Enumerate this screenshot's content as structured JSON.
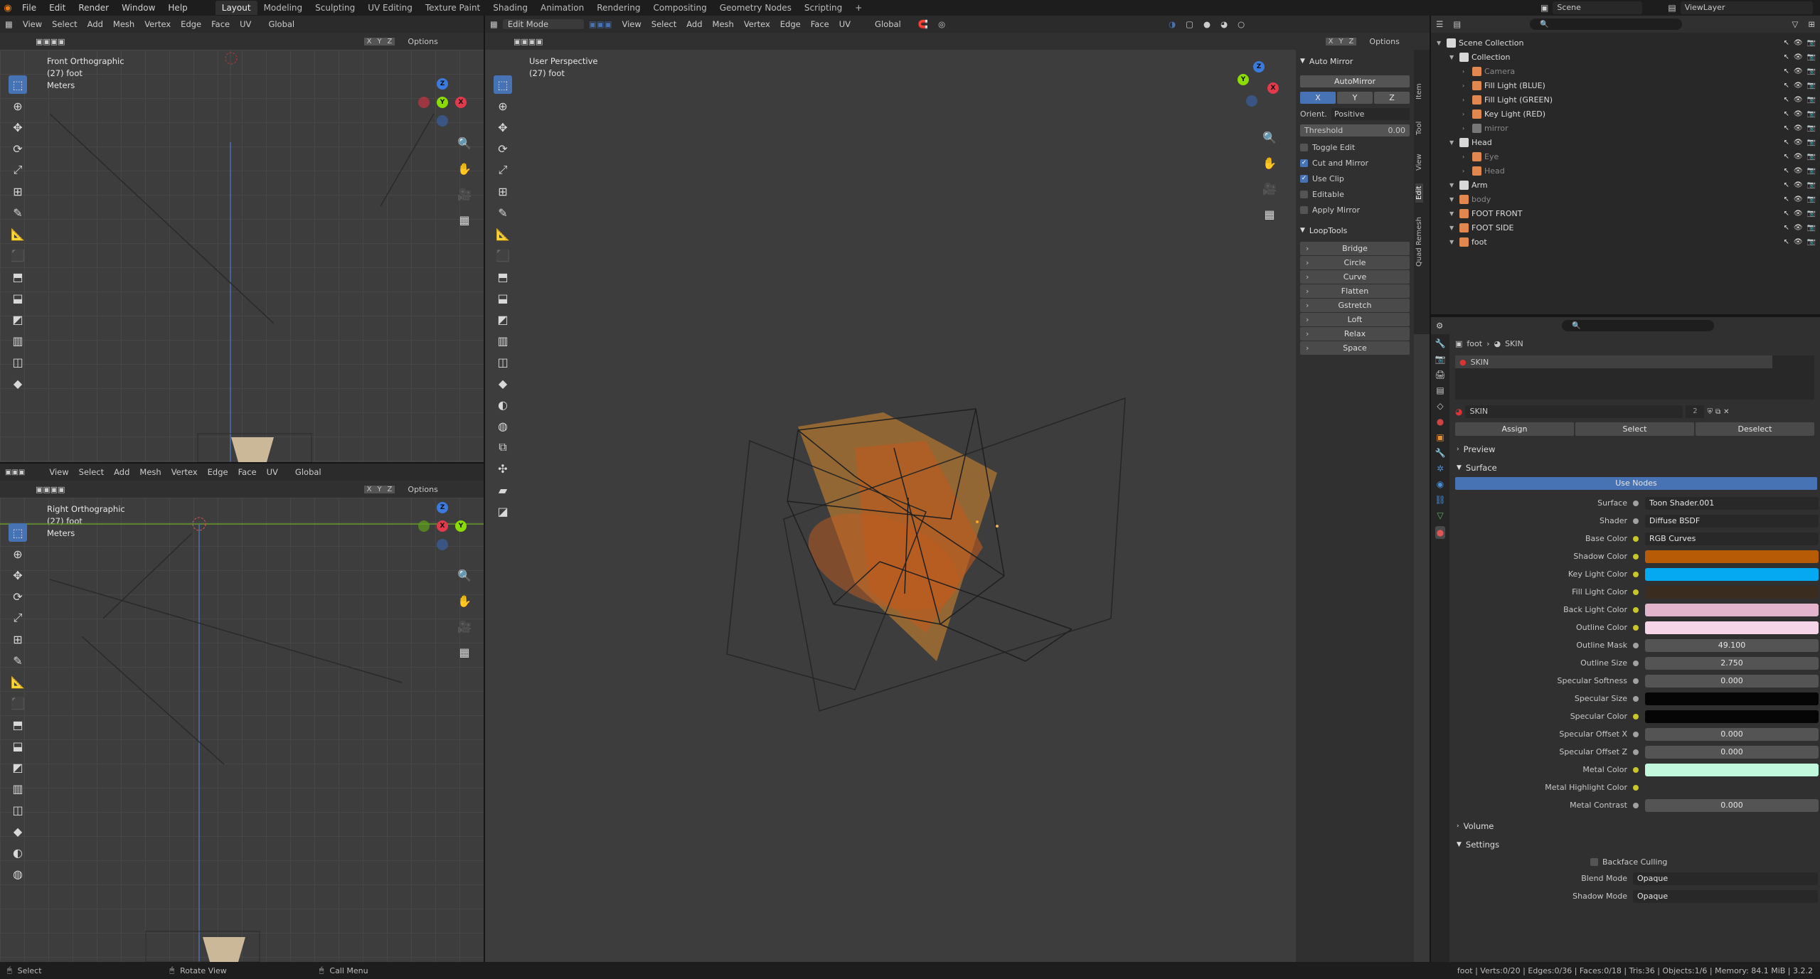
{
  "menus": [
    "File",
    "Edit",
    "Render",
    "Window",
    "Help"
  ],
  "workspaces": [
    "Layout",
    "Modeling",
    "Sculpting",
    "UV Editing",
    "Texture Paint",
    "Shading",
    "Animation",
    "Rendering",
    "Compositing",
    "Geometry Nodes",
    "Scripting",
    "+"
  ],
  "scene": {
    "label": "Scene",
    "view_layer": "ViewLayer"
  },
  "viewport_header": {
    "items": [
      "View",
      "Select",
      "Add",
      "Mesh",
      "Vertex",
      "Edge",
      "Face",
      "UV"
    ],
    "orientation": "Global",
    "mode": "Edit Mode",
    "options": "Options",
    "axes": [
      "X",
      "Y",
      "Z"
    ]
  },
  "front_view": {
    "name": "Front Orthographic",
    "object": "(27) foot",
    "units": "Meters"
  },
  "right_view": {
    "name": "Right Orthographic",
    "object": "(27) foot",
    "units": "Meters"
  },
  "main_view": {
    "name": "User Perspective",
    "object": "(27) foot"
  },
  "npanel": {
    "tabs": [
      "Item",
      "Tool",
      "View",
      "Edit",
      "Quad Remesh"
    ],
    "automirror_title": "Auto Mirror",
    "automirror_btn": "AutoMirror",
    "axis": [
      "X",
      "Y",
      "Z"
    ],
    "orient_label": "Orient.",
    "orient_value": "Positive",
    "threshold_label": "Threshold",
    "threshold_value": "0.00",
    "checks": [
      {
        "label": "Toggle Edit",
        "on": false
      },
      {
        "label": "Cut and Mirror",
        "on": true
      },
      {
        "label": "Use Clip",
        "on": true
      },
      {
        "label": "Editable",
        "on": false
      },
      {
        "label": "Apply Mirror",
        "on": false
      }
    ],
    "looptools_title": "LoopTools",
    "looptools": [
      "Bridge",
      "Circle",
      "Curve",
      "Flatten",
      "Gstretch",
      "Loft",
      "Relax",
      "Space"
    ]
  },
  "outliner": {
    "rows": [
      {
        "name": "Scene Collection",
        "indent": 0,
        "dim": false,
        "color": "#d8d8d8"
      },
      {
        "name": "Collection",
        "indent": 1,
        "dim": false,
        "color": "#d8d8d8"
      },
      {
        "name": "Camera",
        "indent": 2,
        "dim": true,
        "color": "#e08850"
      },
      {
        "name": "Fill Light (BLUE)",
        "indent": 2,
        "dim": false,
        "color": "#e08850"
      },
      {
        "name": "Fill Light (GREEN)",
        "indent": 2,
        "dim": false,
        "color": "#e08850"
      },
      {
        "name": "Key Light (RED)",
        "indent": 2,
        "dim": false,
        "color": "#e08850"
      },
      {
        "name": "mirror",
        "indent": 2,
        "dim": true,
        "color": "#777777"
      },
      {
        "name": "Head",
        "indent": 1,
        "dim": false,
        "color": "#d8d8d8"
      },
      {
        "name": "Eye",
        "indent": 2,
        "dim": true,
        "color": "#e08850"
      },
      {
        "name": "Head",
        "indent": 2,
        "dim": true,
        "color": "#e08850"
      },
      {
        "name": "Arm",
        "indent": 1,
        "dim": false,
        "color": "#d8d8d8"
      },
      {
        "name": "body",
        "indent": 1,
        "dim": true,
        "color": "#e08850"
      },
      {
        "name": "FOOT FRONT",
        "indent": 1,
        "dim": false,
        "color": "#e08850"
      },
      {
        "name": "FOOT SIDE",
        "indent": 1,
        "dim": false,
        "color": "#e08850"
      },
      {
        "name": "foot",
        "indent": 1,
        "dim": false,
        "color": "#e08850"
      }
    ]
  },
  "properties": {
    "breadcrumb_object": "foot",
    "breadcrumb_material": "SKIN",
    "slot": "SKIN",
    "material_name": "SKIN",
    "users": "2",
    "assign": "Assign",
    "select": "Select",
    "deselect": "Deselect",
    "preview": "Preview",
    "surface": "Surface",
    "use_nodes": "Use Nodes",
    "rows": [
      {
        "label": "Surface",
        "value": "Toon Shader.001",
        "type": "text",
        "dot": "g"
      },
      {
        "label": "Shader",
        "value": "Diffuse BSDF",
        "type": "text",
        "dot": "g"
      },
      {
        "label": "Base Color",
        "value": "RGB Curves",
        "type": "text",
        "dot": "y"
      },
      {
        "label": "Shadow Color",
        "value": "",
        "type": "color",
        "color": "#b85b07",
        "dot": "y"
      },
      {
        "label": "Key Light Color",
        "value": "",
        "type": "color",
        "color": "#05a9f2",
        "dot": "y"
      },
      {
        "label": "Fill Light Color",
        "value": "",
        "type": "color",
        "color": "#3a2c1e",
        "dot": "y"
      },
      {
        "label": "Back Light Color",
        "value": "",
        "type": "color",
        "color": "#e3b5cc",
        "dot": "y"
      },
      {
        "label": "Outline Color",
        "value": "",
        "type": "color",
        "color": "#f7d5e9",
        "dot": "y"
      },
      {
        "label": "Outline Mask",
        "value": "49.100",
        "type": "num",
        "dot": "g"
      },
      {
        "label": "Outline Size",
        "value": "2.750",
        "type": "num",
        "dot": "g"
      },
      {
        "label": "Specular Softness",
        "value": "0.000",
        "type": "num",
        "dot": "g"
      },
      {
        "label": "Specular Size",
        "value": "",
        "type": "color",
        "color": "#050505",
        "dot": "g"
      },
      {
        "label": "Specular Color",
        "value": "",
        "type": "color",
        "color": "#050505",
        "dot": "y"
      },
      {
        "label": "Specular Offset X",
        "value": "0.000",
        "type": "num",
        "dot": "g"
      },
      {
        "label": "Specular Offset Z",
        "value": "0.000",
        "type": "num",
        "dot": "g"
      },
      {
        "label": "Metal Color",
        "value": "",
        "type": "color",
        "color": "#c1f7dc",
        "dot": "y"
      },
      {
        "label": "Metal Highlight Color",
        "value": "",
        "type": "color",
        "color": "#303030",
        "dot": "y"
      },
      {
        "label": "Metal Contrast",
        "value": "0.000",
        "type": "num",
        "dot": "g"
      }
    ],
    "volume": "Volume",
    "settings": "Settings",
    "backface": "Backface Culling",
    "blend_label": "Blend Mode",
    "blend_value": "Opaque",
    "shadow_label": "Shadow Mode",
    "shadow_value": "Opaque"
  },
  "status": {
    "select": "Select",
    "rotate": "Rotate View",
    "call": "Call Menu",
    "stats": "foot | Verts:0/20 | Edges:0/36 | Faces:0/18 | Tris:36 | Objects:1/6 | Memory: 84.1 MiB | 3.2.2"
  }
}
